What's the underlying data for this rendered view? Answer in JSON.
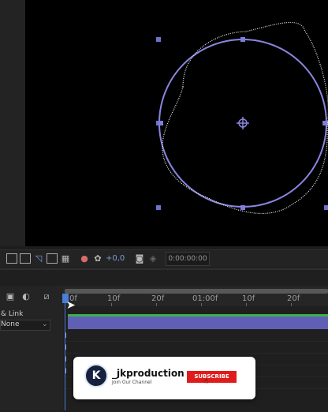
{
  "viewer_toolbar": {
    "icons": [
      "region-icon",
      "transparency-grid-icon",
      "mask-toggle-icon",
      "safe-zones-icon",
      "grid-icon",
      "channels-icon",
      "exposure-reset-icon"
    ],
    "exposure_value": "+0,0",
    "timecode": "0:00:00:00"
  },
  "timeline": {
    "ruler_labels": [
      "0f",
      "10f",
      "20f",
      "01:00f",
      "10f",
      "20f"
    ],
    "parent_label": "& Link",
    "parent_value": "None",
    "colors": {
      "layer_bar": "#5f60b5",
      "playhead": "#4a7fd8",
      "track_matte_green": "#3db04a"
    }
  },
  "composition": {
    "shape": "ellipse with warped stroke",
    "colors": {
      "path": "#8a86e0",
      "handles": "#7d7fd8",
      "warped_stroke": "#e8e8e8"
    }
  },
  "subscribe_card": {
    "logo_text": "K",
    "channel_name": "_jkproduction",
    "tagline": "Join Our Channel",
    "button_label": "SUBSCRIBE"
  }
}
